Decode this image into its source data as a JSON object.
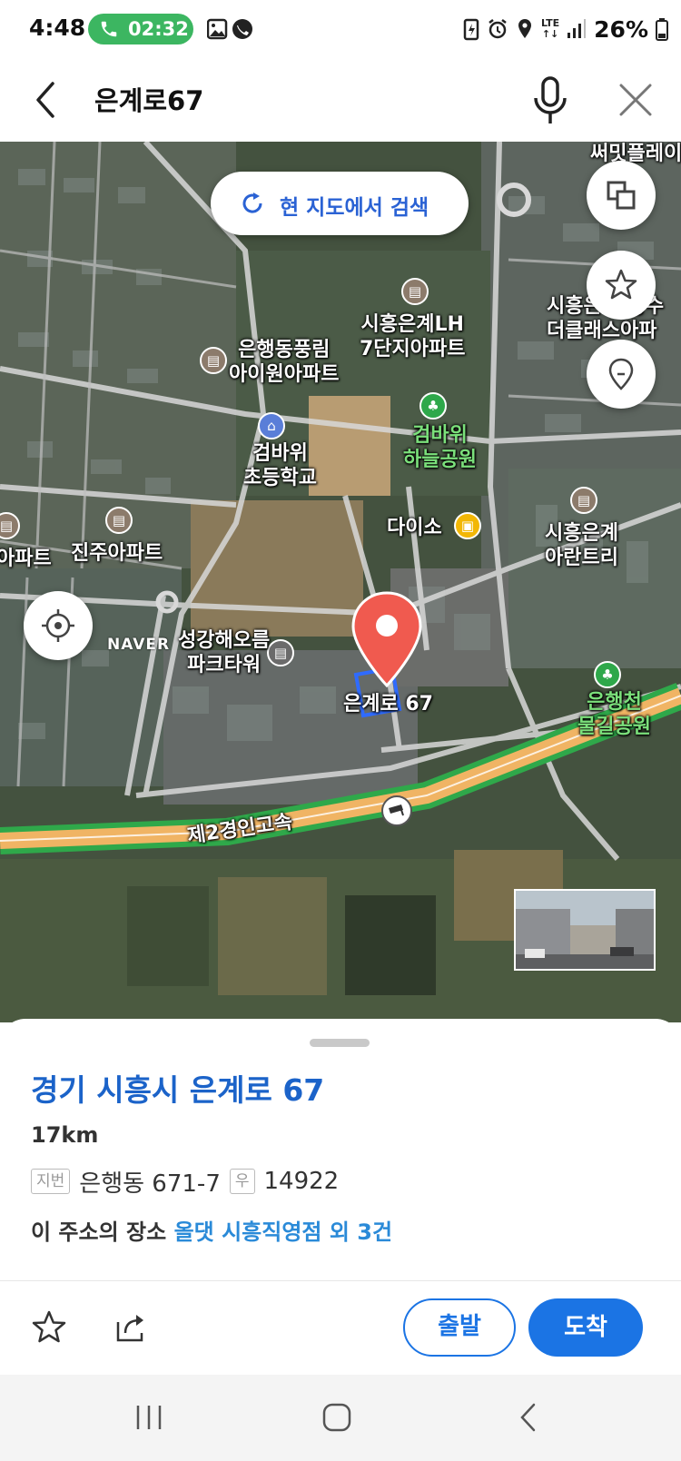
{
  "status_bar": {
    "time": "4:48",
    "call_timer": "02:32",
    "network": "LTE",
    "battery": "26%"
  },
  "header": {
    "title": "은계로67"
  },
  "map": {
    "search_here": "현 지도에서 검색",
    "brand": "NAVER",
    "labels": {
      "summit": "써밋플레이",
      "siheung_lh": "시흥은계LH\n7단지아파트",
      "eunhaeng_pungrim": "은행동풍림\n아이원아파트",
      "geombawi_school": "검바위\n초등학교",
      "geombawi_park": "검바위\n하늘공원",
      "daiso": "다이소",
      "eungye_arantree": "시흥은계\n아란트리",
      "jinju_apt": "진주아파트",
      "apt_left": "아파트",
      "gangae_park_tower": "성강해오름\n파크타워",
      "eungyero67": "은계로 67",
      "eunhaengcheon": "은행천\n물길공원",
      "highway": "제2경인고속",
      "top_right": "시흥은계 양수\n더클래스아파"
    }
  },
  "sheet": {
    "address_title": "경기 시흥시 은계로 67",
    "distance": "17km",
    "lot_tag": "지번",
    "lot_value": "은행동 671-7",
    "postal_tag": "우",
    "postal_value": "14922",
    "places_prefix": "이 주소의 장소",
    "places_link": "올댓 시흥직영점 외 3건",
    "depart_label": "출발",
    "arrive_label": "도착"
  },
  "colors": {
    "accent": "#1b74e4",
    "title_blue": "#1b63c9",
    "call_green": "#3cb661",
    "pin_red": "#f05a4f"
  },
  "icons": [
    "back-icon",
    "mic-icon",
    "close-icon",
    "refresh-icon",
    "layers-icon",
    "star-icon",
    "location-pin-icon",
    "locate-me-icon",
    "cctv-icon",
    "share-icon"
  ]
}
